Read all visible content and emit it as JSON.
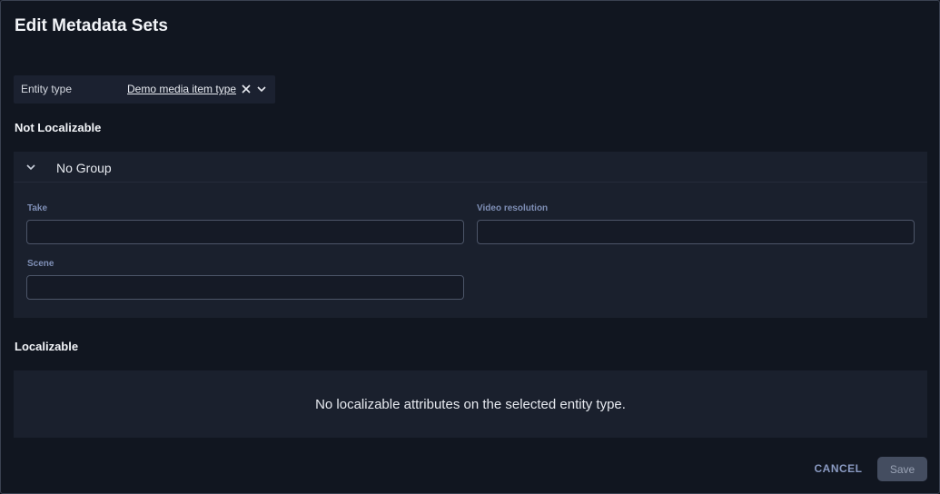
{
  "dialog": {
    "title": "Edit Metadata Sets"
  },
  "entity_type": {
    "label": "Entity type",
    "value": "Demo media item type",
    "clear_icon": "close-icon",
    "dropdown_icon": "chevron-down-icon"
  },
  "not_localizable": {
    "heading": "Not Localizable",
    "group": {
      "title": "No Group",
      "chevron_icon": "chevron-down-icon",
      "fields": [
        {
          "label": "Take",
          "value": ""
        },
        {
          "label": "Video resolution",
          "value": ""
        },
        {
          "label": "Scene",
          "value": ""
        }
      ]
    }
  },
  "localizable": {
    "heading": "Localizable",
    "empty_message": "No localizable attributes on the selected entity type."
  },
  "footer": {
    "cancel_label": "CANCEL",
    "save_label": "Save"
  },
  "colors": {
    "background": "#111620",
    "panel": "#1a202d",
    "field_label": "#7f8fb6",
    "cancel_text": "#8a9ac2",
    "save_disabled_bg": "#444d60"
  }
}
